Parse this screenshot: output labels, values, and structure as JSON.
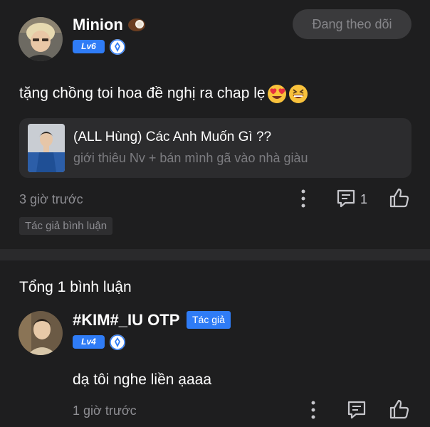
{
  "post": {
    "username": "Minion",
    "username_emoji": "coconut-emoji",
    "level": "Lv6",
    "follow_button": "Đang theo dõi",
    "text": "tặng chồng toi hoa đề nghị ra chap lẹ",
    "text_emojis": [
      "heart-eyes-emoji",
      "grinning-squinting-emoji"
    ],
    "card": {
      "title": "(ALL Hùng) Các Anh Muốn Gì ??",
      "subtitle": "giới thiêu Nv + bán mình gã vào nhà giàu"
    },
    "time": "3 giờ trước",
    "reply_count": "1",
    "author_tag": "Tác giả bình luận"
  },
  "comments_section": {
    "total_label": "Tổng 1 bình luận",
    "reply": {
      "username": "#KIM#_IU OTP",
      "author_badge": "Tác giả",
      "level": "Lv4",
      "text": "dạ tôi nghe liền ạaaa",
      "time": "1 giờ trước"
    }
  },
  "icons": [
    "more-vertical-icon",
    "comment-icon",
    "like-thumb-icon",
    "shield-level-icon"
  ],
  "colors": {
    "background": "#1e1e1f",
    "accent": "#2f7cf6",
    "muted_text": "#8e8e93"
  }
}
